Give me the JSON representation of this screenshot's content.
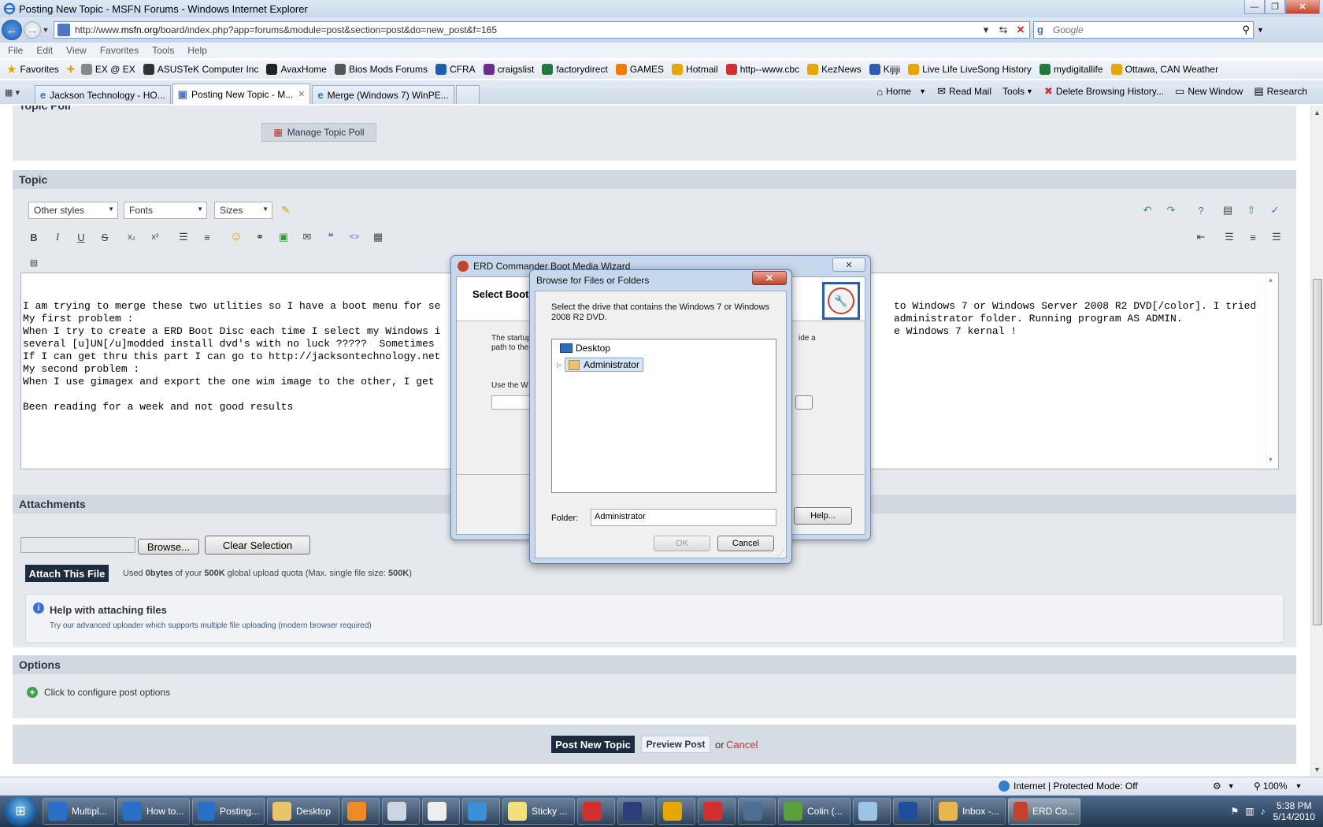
{
  "window": {
    "title": "Posting New Topic - MSFN Forums - Windows Internet Explorer",
    "min_glyph": "—",
    "max_glyph": "❐",
    "close_glyph": "✕"
  },
  "address": {
    "url_prefix": "http://www.",
    "url_domain": "msfn.org",
    "url_rest": "/board/index.php?app=forums&module=post&section=post&do=new_post&f=165",
    "search_placeholder": "Google"
  },
  "menu": [
    "File",
    "Edit",
    "View",
    "Favorites",
    "Tools",
    "Help"
  ],
  "favorites": {
    "label": "Favorites",
    "items": [
      {
        "label": "EX @ EX",
        "icon": "ex-icon",
        "color": "#888888"
      },
      {
        "label": "ASUSTeK Computer Inc",
        "icon": "asus-icon",
        "color": "#333333"
      },
      {
        "label": "AvaxHome",
        "icon": "yinyang-icon",
        "color": "#222222"
      },
      {
        "label": "Bios Mods Forums",
        "icon": "bios-icon",
        "color": "#555555"
      },
      {
        "label": "CFRA",
        "icon": "cfra-icon",
        "color": "#1a5fb4"
      },
      {
        "label": "craigslist",
        "icon": "peace-icon",
        "color": "#6a2c91"
      },
      {
        "label": "factorydirect",
        "icon": "globe-icon",
        "color": "#1f7a3e"
      },
      {
        "label": "GAMES",
        "icon": "blogger-icon",
        "color": "#f57c00"
      },
      {
        "label": "Hotmail",
        "icon": "hotmail-icon",
        "color": "#e6a700"
      },
      {
        "label": "http--www.cbc",
        "icon": "cbc-icon",
        "color": "#d32f2f"
      },
      {
        "label": "KezNews",
        "icon": "keznews-icon",
        "color": "#e6a700"
      },
      {
        "label": "Kijiji",
        "icon": "kijiji-icon",
        "color": "#2b5bb5"
      },
      {
        "label": "Live Life LiveSong History",
        "icon": "livesong-icon",
        "color": "#e6a700"
      },
      {
        "label": "mydigitallife",
        "icon": "globe-icon",
        "color": "#1f7a3e"
      },
      {
        "label": "Ottawa, CAN Weather",
        "icon": "weather-icon",
        "color": "#e6a700"
      }
    ]
  },
  "tabs": [
    {
      "label": "Jackson Technology - HO...",
      "active": false
    },
    {
      "label": "Posting New Topic - M...",
      "active": true
    },
    {
      "label": "Merge (Windows 7) WinPE...",
      "active": false
    }
  ],
  "commandbar": {
    "home": "Home",
    "read_mail": "Read Mail",
    "tools": "Tools",
    "delete_history": "Delete Browsing History...",
    "new_window": "New Window",
    "research": "Research"
  },
  "page": {
    "topic_poll_heading": "Topic Poll",
    "manage_poll": "Manage Topic Poll",
    "topic_heading": "Topic",
    "toolbar": {
      "styles": "Other styles",
      "fonts": "Fonts",
      "sizes": "Sizes"
    },
    "editor_text": "I am trying to merge these two utlities so I have a boot menu for se\nMy first problem :\nWhen I try to create a ERD Boot Disc each time I select my Windows i\nseveral [u]UN[/u]modded install dvd's with no luck ?????  Sometimes \nIf I can get thru this part I can go to http://jacksontechnology.net\nMy second problem :\nWhen I use gimagex and export the one wim image to the other, I get \n\nBeen reading for a week and not good results",
    "editor_text_right": "to Windows 7 or Windows Server 2008 R2 DVD[/color]. I tried\nadministrator folder. Running program AS ADMIN.\ne Windows 7 kernal !",
    "attachments_heading": "Attachments",
    "browse_btn": "Browse...",
    "clear_btn": "Clear Selection",
    "attach_btn": "Attach This File",
    "quota_pre": "Used ",
    "quota_used": "0bytes",
    "quota_mid": " of your ",
    "quota_total": "500K",
    "quota_mid2": " global upload quota (Max. single file size: ",
    "quota_max": "500K",
    "quota_end": ")",
    "help_title": "Help with attaching files",
    "help_text": "Try our advanced uploader which supports multiple file uploading (modern browser required)",
    "options_heading": "Options",
    "options_link": "Click to configure post options",
    "post_btn": "Post New Topic",
    "preview_btn": "Preview Post",
    "or_text": "or",
    "cancel_link": "Cancel"
  },
  "erd_dialog": {
    "title": "ERD Commander Boot Media Wizard",
    "header": "Select Boot",
    "desc_left": "The startup",
    "desc_left2": "path to the",
    "desc_right": "ide a",
    "use_label": "Use the W",
    "help_btn": "Help..."
  },
  "browse_dialog": {
    "title": "Browse for Files or Folders",
    "instruction": "Select the drive that contains the Windows 7 or Windows 2008 R2 DVD.",
    "tree": [
      {
        "label": "Desktop",
        "icon": "desktop-icon",
        "selected": false
      },
      {
        "label": "Administrator",
        "icon": "user-folder-icon",
        "selected": true
      }
    ],
    "folder_label": "Folder:",
    "folder_value": "Administrator",
    "ok_btn": "OK",
    "cancel_btn": "Cancel"
  },
  "statusbar": {
    "zone": "Internet | Protected Mode: Off",
    "zoom": "100%"
  },
  "taskbar": {
    "items": [
      {
        "label": "Multipl...",
        "icon": "ie-icon",
        "color": "#2a6fc9"
      },
      {
        "label": "How to...",
        "icon": "ie-icon",
        "color": "#2a6fc9"
      },
      {
        "label": "Posting...",
        "icon": "ie-icon",
        "color": "#2a6fc9"
      },
      {
        "label": "Desktop",
        "icon": "folder-icon",
        "color": "#e9c46a"
      },
      {
        "label": "",
        "icon": "media-player-icon",
        "color": "#f08a24"
      },
      {
        "label": "",
        "icon": "help-files-icon",
        "color": "#ccd5e0"
      },
      {
        "label": "",
        "icon": "alien-icon",
        "color": "#eeeeee"
      },
      {
        "label": "",
        "icon": "computer-icon",
        "color": "#3b8fd6"
      },
      {
        "label": "Sticky ...",
        "icon": "sticky-notes-icon",
        "color": "#f3e07a"
      },
      {
        "label": "",
        "icon": "x-tool-icon",
        "color": "#d32f2f"
      },
      {
        "label": "",
        "icon": "castle-icon",
        "color": "#2b3f7a"
      },
      {
        "label": "",
        "icon": "n-app-icon",
        "color": "#e6a700"
      },
      {
        "label": "",
        "icon": "home-app-icon",
        "color": "#d32f2f"
      },
      {
        "label": "",
        "icon": "window-app-icon",
        "color": "#4c6f96"
      },
      {
        "label": "Colin (...",
        "icon": "messenger-icon",
        "color": "#5aa03c"
      },
      {
        "label": "",
        "icon": "notepad-icon",
        "color": "#9cc4e4"
      },
      {
        "label": "",
        "icon": "word-icon",
        "color": "#1f4e9c"
      },
      {
        "label": "Inbox -...",
        "icon": "outlook-icon",
        "color": "#e8b64a"
      },
      {
        "label": "ERD Co...",
        "icon": "erd-icon",
        "color": "#c9402a"
      }
    ],
    "time": "5:38 PM",
    "date": "5/14/2010"
  }
}
